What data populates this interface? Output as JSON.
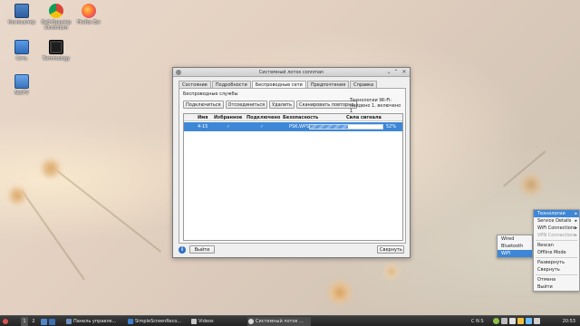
{
  "desktop": {
    "icons": [
      {
        "label": "Компьютер",
        "name": "computer-icon"
      },
      {
        "label": "Веб-браузер Chromium",
        "name": "chromium-icon"
      },
      {
        "label": "Firefox Esr",
        "name": "firefox-icon"
      },
      {
        "label": "Сеть",
        "name": "network-folder-icon"
      },
      {
        "label": "Terminology",
        "name": "terminal-icon"
      },
      {
        "label": "NetTV",
        "name": "nettv-icon"
      }
    ]
  },
  "window": {
    "title": "Системный лоток connman",
    "tabs": [
      "Состояние",
      "Подробности",
      "Беспроводные сети",
      "Предпочтения",
      "Справка"
    ],
    "active_tab": 2,
    "group_label": "Беспроводные службы",
    "buttons": [
      "Подключиться",
      "Отсоединиться",
      "Удалить",
      "Сканировать повторно"
    ],
    "tech_note": "Технологии Wi-Fi: найдено 1, включено 1",
    "table": {
      "headers": [
        "Имя",
        "Избранное",
        "Подключено",
        "Безопасность",
        "Сила сигнала"
      ],
      "rows": [
        {
          "name": "4-15",
          "favorite": "✓",
          "connected": "✓",
          "security": "PSK,WPS",
          "signal": 52,
          "signal_text": "52%"
        }
      ]
    },
    "footer": {
      "exit_label": "Выйти",
      "minimize_label": "Свернуть"
    }
  },
  "submenu": {
    "items": [
      "Wired",
      "Bluetooth",
      "WiFi"
    ],
    "highlighted": "WiFi"
  },
  "tray_menu": {
    "items": [
      {
        "label": "Технологии",
        "arrow": "▸",
        "state": "highlighted"
      },
      {
        "label": "Service Details",
        "arrow": "▸",
        "state": "normal"
      },
      {
        "label": "WiFi Connections",
        "arrow": "▸",
        "state": "normal"
      },
      {
        "label": "VPN Connections",
        "arrow": "▸",
        "state": "disabled"
      },
      {
        "label": "Rescan",
        "state": "normal"
      },
      {
        "label": "Offline Mode",
        "state": "normal"
      },
      {
        "label": "Развернуть",
        "state": "normal"
      },
      {
        "label": "Свернуть",
        "state": "normal"
      },
      {
        "label": "Отмена",
        "state": "normal"
      },
      {
        "label": "Выйти",
        "state": "normal"
      }
    ]
  },
  "taskbar": {
    "workspaces": [
      "1",
      "2"
    ],
    "tasks": [
      {
        "label": "Панель управле...",
        "name": "control-panel-task"
      },
      {
        "label": "SimpleScreenReco...",
        "name": "screen-recorder-task"
      },
      {
        "label": "Videos",
        "name": "videos-task"
      },
      {
        "label": "Системный лоток ...",
        "name": "connman-tray-task"
      }
    ],
    "keyboard_indicators": "C N S",
    "clock": "20:53"
  },
  "colors": {
    "selection": "#3d87d6",
    "taskbar": "#2b2b2b",
    "window_bg": "#efefef"
  }
}
